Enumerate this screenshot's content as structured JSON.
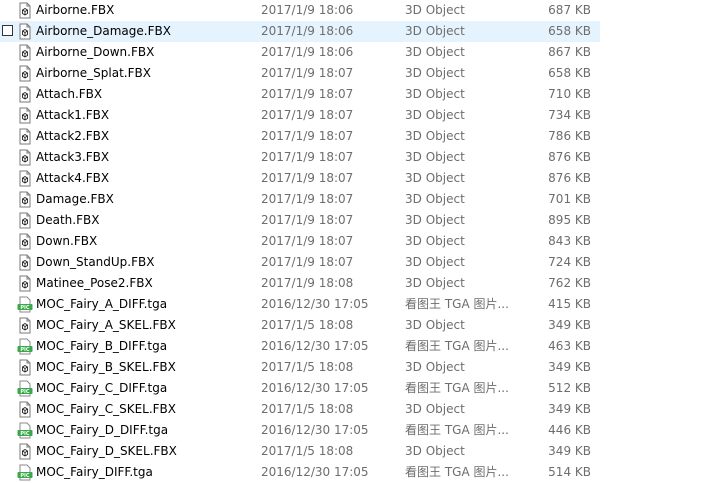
{
  "files": [
    {
      "name": "Airborne.FBX",
      "modified": "2017/1/9 18:06",
      "type": "3D Object",
      "size": "687 KB",
      "icon": "fbx-file-icon"
    },
    {
      "name": "Airborne_Damage.FBX",
      "modified": "2017/1/9 18:06",
      "type": "3D Object",
      "size": "658 KB",
      "icon": "fbx-file-icon",
      "hovered": true
    },
    {
      "name": "Airborne_Down.FBX",
      "modified": "2017/1/9 18:06",
      "type": "3D Object",
      "size": "867 KB",
      "icon": "fbx-file-icon"
    },
    {
      "name": "Airborne_Splat.FBX",
      "modified": "2017/1/9 18:07",
      "type": "3D Object",
      "size": "658 KB",
      "icon": "fbx-file-icon"
    },
    {
      "name": "Attach.FBX",
      "modified": "2017/1/9 18:07",
      "type": "3D Object",
      "size": "710 KB",
      "icon": "fbx-file-icon"
    },
    {
      "name": "Attack1.FBX",
      "modified": "2017/1/9 18:07",
      "type": "3D Object",
      "size": "734 KB",
      "icon": "fbx-file-icon"
    },
    {
      "name": "Attack2.FBX",
      "modified": "2017/1/9 18:07",
      "type": "3D Object",
      "size": "786 KB",
      "icon": "fbx-file-icon"
    },
    {
      "name": "Attack3.FBX",
      "modified": "2017/1/9 18:07",
      "type": "3D Object",
      "size": "876 KB",
      "icon": "fbx-file-icon"
    },
    {
      "name": "Attack4.FBX",
      "modified": "2017/1/9 18:07",
      "type": "3D Object",
      "size": "876 KB",
      "icon": "fbx-file-icon"
    },
    {
      "name": "Damage.FBX",
      "modified": "2017/1/9 18:07",
      "type": "3D Object",
      "size": "701 KB",
      "icon": "fbx-file-icon"
    },
    {
      "name": "Death.FBX",
      "modified": "2017/1/9 18:07",
      "type": "3D Object",
      "size": "895 KB",
      "icon": "fbx-file-icon"
    },
    {
      "name": "Down.FBX",
      "modified": "2017/1/9 18:07",
      "type": "3D Object",
      "size": "843 KB",
      "icon": "fbx-file-icon"
    },
    {
      "name": "Down_StandUp.FBX",
      "modified": "2017/1/9 18:07",
      "type": "3D Object",
      "size": "724 KB",
      "icon": "fbx-file-icon"
    },
    {
      "name": "Matinee_Pose2.FBX",
      "modified": "2017/1/9 18:08",
      "type": "3D Object",
      "size": "762 KB",
      "icon": "fbx-file-icon"
    },
    {
      "name": "MOC_Fairy_A_DIFF.tga",
      "modified": "2016/12/30 17:05",
      "type": "看图王 TGA 图片...",
      "size": "415 KB",
      "icon": "tga-image-icon"
    },
    {
      "name": "MOC_Fairy_A_SKEL.FBX",
      "modified": "2017/1/5 18:08",
      "type": "3D Object",
      "size": "349 KB",
      "icon": "fbx-file-icon"
    },
    {
      "name": "MOC_Fairy_B_DIFF.tga",
      "modified": "2016/12/30 17:05",
      "type": "看图王 TGA 图片...",
      "size": "463 KB",
      "icon": "tga-image-icon"
    },
    {
      "name": "MOC_Fairy_B_SKEL.FBX",
      "modified": "2017/1/5 18:08",
      "type": "3D Object",
      "size": "349 KB",
      "icon": "fbx-file-icon"
    },
    {
      "name": "MOC_Fairy_C_DIFF.tga",
      "modified": "2016/12/30 17:05",
      "type": "看图王 TGA 图片...",
      "size": "512 KB",
      "icon": "tga-image-icon"
    },
    {
      "name": "MOC_Fairy_C_SKEL.FBX",
      "modified": "2017/1/5 18:08",
      "type": "3D Object",
      "size": "349 KB",
      "icon": "fbx-file-icon"
    },
    {
      "name": "MOC_Fairy_D_DIFF.tga",
      "modified": "2016/12/30 17:05",
      "type": "看图王 TGA 图片...",
      "size": "446 KB",
      "icon": "tga-image-icon"
    },
    {
      "name": "MOC_Fairy_D_SKEL.FBX",
      "modified": "2017/1/5 18:08",
      "type": "3D Object",
      "size": "349 KB",
      "icon": "fbx-file-icon"
    },
    {
      "name": "MOC_Fairy_DIFF.tga",
      "modified": "2016/12/30 17:05",
      "type": "看图王 TGA 图片...",
      "size": "514 KB",
      "icon": "tga-image-icon"
    }
  ],
  "colors": {
    "hover_bg": "#e5f3ff",
    "meta_text": "#6d6d6d",
    "tga_badge": "#3aa84a"
  }
}
